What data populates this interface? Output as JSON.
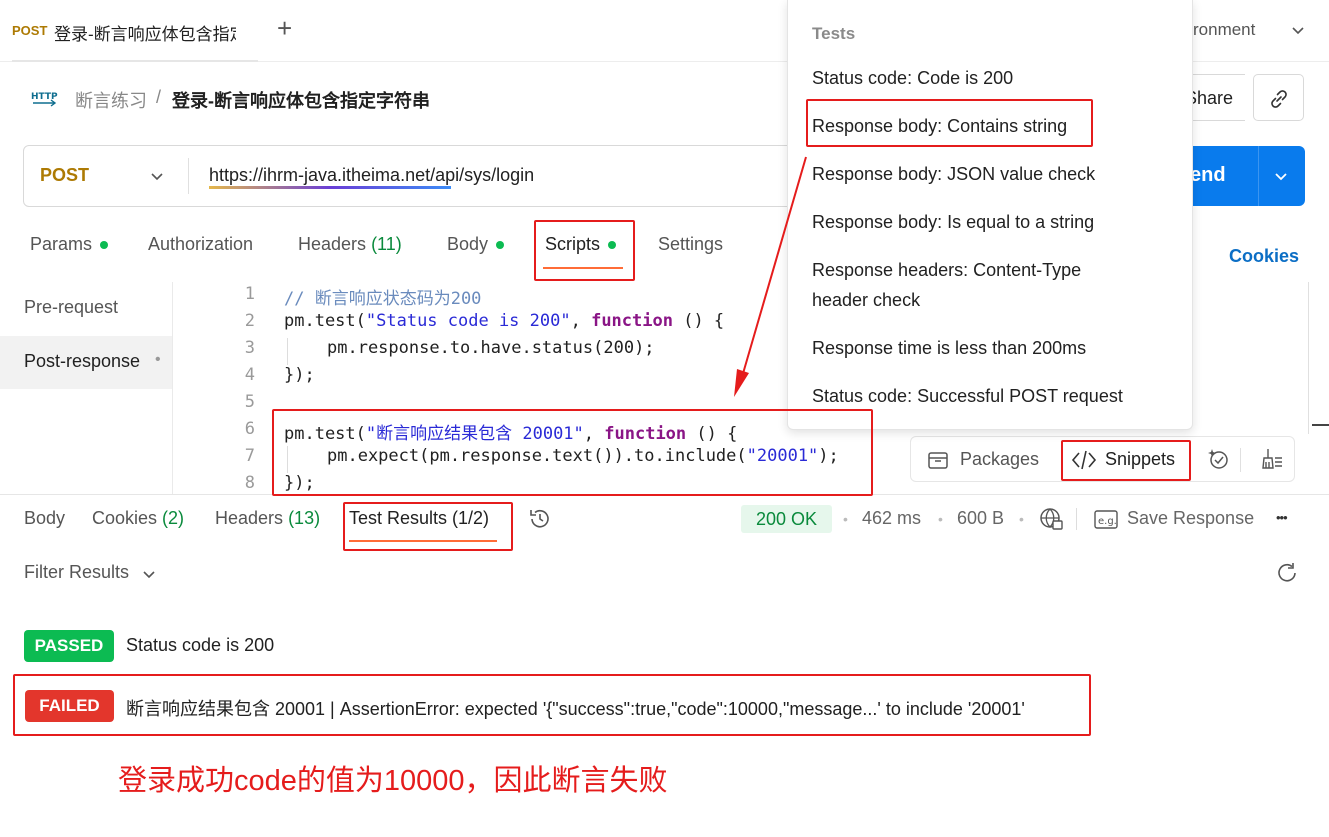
{
  "tabs": {
    "active_method": "POST",
    "active_title": "登录-断言响应体包含指定",
    "add_icon": "plus-icon",
    "environment_label": "ronment"
  },
  "breadcrumb": {
    "icon": "http-icon",
    "collection": "断言练习",
    "separator": "/",
    "request": "登录-断言响应体包含指定字符串"
  },
  "header_actions": {
    "share_label": "Share",
    "link_icon": "link-icon"
  },
  "url_bar": {
    "method": "POST",
    "url": "https://ihrm-java.itheima.net/api/sys/login",
    "send_label": "end"
  },
  "request_tabs": {
    "params": "Params",
    "authorization": "Authorization",
    "headers": "Headers",
    "headers_count": "(11)",
    "body": "Body",
    "scripts": "Scripts",
    "settings": "Settings",
    "cookies": "Cookies"
  },
  "script_side": {
    "pre_request": "Pre-request",
    "post_response": "Post-response",
    "dot": "•"
  },
  "code": {
    "line_numbers": [
      "1",
      "2",
      "3",
      "4",
      "5",
      "6",
      "7",
      "8"
    ],
    "l1": "// 断言响应状态码为200",
    "l2_a": "pm.test(",
    "l2_str": "\"Status code is 200\"",
    "l2_b": ", ",
    "l2_kw": "function",
    "l2_c": " () {",
    "l3_a": "pm.response.to.have.status(",
    "l3_num": "200",
    "l3_b": ");",
    "l4": "});",
    "l6_a": "pm.test(",
    "l6_str": "\"断言响应结果包含 20001\"",
    "l6_b": ", ",
    "l6_kw": "function",
    "l6_c": " () {",
    "l7_a": "pm.expect(pm.response.text()).to.include(",
    "l7_str": "\"20001\"",
    "l7_b": ");",
    "l8": "});"
  },
  "toolbar": {
    "packages": "Packages",
    "snippets": "Snippets"
  },
  "response": {
    "body": "Body",
    "cookies": "Cookies",
    "cookies_count": "(2)",
    "headers": "Headers",
    "headers_count": "(13)",
    "test_results": "Test Results (1/2)",
    "status": "200 OK",
    "time": "462 ms",
    "size": "600 B",
    "sep": "•",
    "save_response": "Save Response",
    "more": "•••",
    "filter": "Filter Results"
  },
  "results": [
    {
      "badge": "PASSED",
      "text": "Status code is 200"
    },
    {
      "badge": "FAILED",
      "text": "断言响应结果包含 20001 | AssertionError: expected '{\"success\":true,\"code\":10000,\"message...' to include '20001'"
    }
  ],
  "annotation": "登录成功code的值为10000，因此断言失败",
  "snippets_menu": {
    "heading": "Tests",
    "items": [
      "Status code: Code is 200",
      "Response body: Contains string",
      "Response body: JSON value check",
      "Response body: Is equal to a string",
      "Response headers: Content-Type",
      "header check",
      "Response time is less than 200ms",
      "Status code: Successful POST request"
    ]
  },
  "colors": {
    "accent_orange": "#ff6c37",
    "send_blue": "#097bed",
    "pass_green": "#0cbb52",
    "fail_red": "#e3362c",
    "highlight_red": "#e51c1c"
  }
}
